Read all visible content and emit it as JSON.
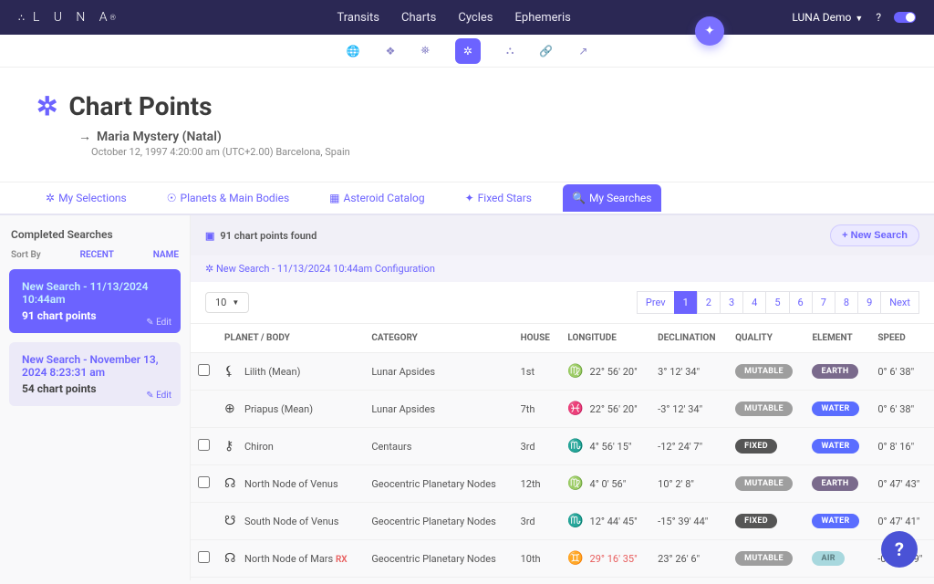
{
  "header": {
    "brand": "L U N A",
    "nav": [
      "Transits",
      "Charts",
      "Cycles",
      "Ephemeris"
    ],
    "user": "LUNA Demo"
  },
  "page": {
    "title": "Chart Points",
    "person": "Maria Mystery (Natal)",
    "meta": "October 12, 1997 4:20:00 am (UTC+2.00) Barcelona, Spain"
  },
  "tabs": {
    "sel": "My Selections",
    "bodies": "Planets & Main Bodies",
    "ast": "Asteroid Catalog",
    "stars": "Fixed Stars",
    "searches": "My Searches"
  },
  "sidebar": {
    "heading": "Completed Searches",
    "sort_label": "Sort By",
    "sort_recent": "RECENT",
    "sort_name": "NAME",
    "items": [
      {
        "title": "New Search - 11/13/2024 10:44am",
        "count": "91 chart points",
        "edit": "Edit"
      },
      {
        "title": "New Search - November 13, 2024 8:23:31 am",
        "count": "54 chart points",
        "edit": "Edit"
      }
    ]
  },
  "results": {
    "found_label": "91 chart points found",
    "new_search_btn": "New Search",
    "config_label": "New Search - 11/13/2024 10:44am Configuration",
    "per_page": "10",
    "pager": {
      "prev": "Prev",
      "next": "Next",
      "pages": [
        "1",
        "2",
        "3",
        "4",
        "5",
        "6",
        "7",
        "8",
        "9"
      ]
    },
    "cols": {
      "body": "PLANET / BODY",
      "cat": "CATEGORY",
      "house": "HOUSE",
      "lon": "LONGITUDE",
      "dec": "DECLINATION",
      "qual": "QUALITY",
      "elem": "ELEMENT",
      "speed": "SPEED"
    },
    "rows": [
      {
        "g": "⚸",
        "body": "Lilith (Mean)",
        "rx": "",
        "cat": "Lunar Apsides",
        "house": "1st",
        "zg": "♍",
        "lon": "22° 56' 20\"",
        "dec": "3° 12' 34\"",
        "qual": "MUTABLE",
        "qcls": "mut",
        "elem": "EARTH",
        "ecls": "earth",
        "speed": "0° 6' 38\"",
        "ck": true
      },
      {
        "g": "⊕",
        "body": "Priapus (Mean)",
        "rx": "",
        "cat": "Lunar Apsides",
        "house": "7th",
        "zg": "♓",
        "lon": "22° 56' 20\"",
        "dec": "-3° 12' 34\"",
        "qual": "MUTABLE",
        "qcls": "mut",
        "elem": "WATER",
        "ecls": "water",
        "speed": "0° 6' 38\"",
        "ck": false
      },
      {
        "g": "⚷",
        "body": "Chiron",
        "rx": "",
        "cat": "Centaurs",
        "house": "3rd",
        "zg": "♏",
        "lon": "4° 56' 15\"",
        "dec": "-12° 24' 7\"",
        "qual": "FIXED",
        "qcls": "fix",
        "elem": "WATER",
        "ecls": "water",
        "speed": "0° 8' 16\"",
        "ck": true
      },
      {
        "g": "☊",
        "body": "North Node of Venus",
        "rx": "",
        "cat": "Geocentric Planetary Nodes",
        "house": "12th",
        "zg": "♍",
        "lon": "4° 0' 56\"",
        "dec": "10° 2' 8\"",
        "qual": "MUTABLE",
        "qcls": "mut",
        "elem": "EARTH",
        "ecls": "earth",
        "speed": "0° 47' 43\"",
        "ck": true
      },
      {
        "g": "☋",
        "body": "South Node of Venus",
        "rx": "",
        "cat": "Geocentric Planetary Nodes",
        "house": "3rd",
        "zg": "♏",
        "lon": "12° 44' 45\"",
        "dec": "-15° 39' 44\"",
        "qual": "FIXED",
        "qcls": "fix",
        "elem": "WATER",
        "ecls": "water",
        "speed": "0° 47' 41\"",
        "ck": false
      },
      {
        "g": "☊",
        "body": "North Node of Mars",
        "rx": "RX",
        "cat": "Geocentric Planetary Nodes",
        "house": "10th",
        "zg": "♊",
        "zcls": "teal",
        "lon": "29° 16' 35\"",
        "loncls": "lonred",
        "dec": "23° 26' 6\"",
        "qual": "MUTABLE",
        "qcls": "mut",
        "elem": "AIR",
        "ecls": "air",
        "speed": "-0° 25' 59\"",
        "ck": true
      }
    ]
  }
}
